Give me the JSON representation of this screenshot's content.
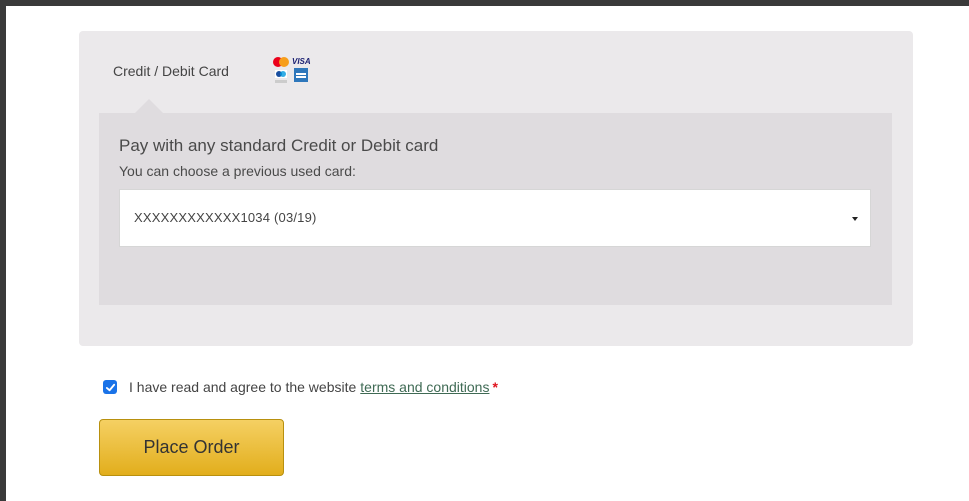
{
  "payment": {
    "method_label": "Credit / Debit Card",
    "card_icons": [
      "mastercard-icon",
      "visa-icon",
      "amex-icon",
      "maestro-icon"
    ],
    "title": "Pay with any standard Credit or Debit card",
    "choose_label": "You can choose a previous used card:",
    "selected_card": "XXXXXXXXXXXX1034 (03/19)"
  },
  "terms": {
    "checked": true,
    "text": "I have read and agree to the website",
    "link_text": "terms and conditions",
    "required_mark": "*"
  },
  "actions": {
    "place_order_label": "Place Order"
  },
  "colors": {
    "button_top": "#f5d063",
    "button_bottom": "#e2ae1c",
    "checkbox": "#1a73e8",
    "link": "#3f6a54",
    "required": "#e0141e"
  }
}
